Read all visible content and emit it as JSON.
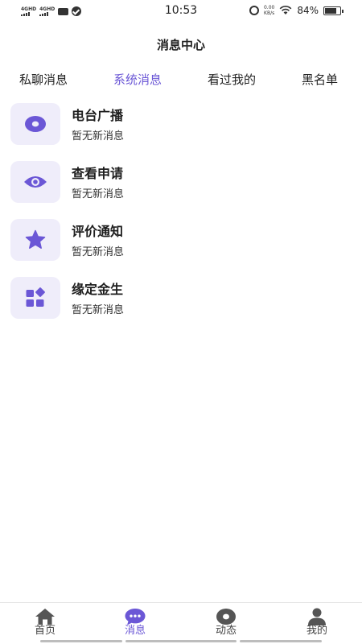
{
  "status_bar": {
    "net1": "4GHD",
    "net2": "4GHD",
    "time": "10:53",
    "speed_value": "0.00",
    "speed_unit": "KB/s",
    "battery": "84%",
    "battery_level": 0.84
  },
  "header": {
    "title": "消息中心"
  },
  "tabs": [
    {
      "label": "私聊消息",
      "active": false
    },
    {
      "label": "系统消息",
      "active": true
    },
    {
      "label": "看过我的",
      "active": false
    },
    {
      "label": "黑名单",
      "active": false
    }
  ],
  "items": [
    {
      "title": "电台广播",
      "subtitle": "暂无新消息",
      "icon": "radio-icon"
    },
    {
      "title": "查看申请",
      "subtitle": "暂无新消息",
      "icon": "eye-icon"
    },
    {
      "title": "评价通知",
      "subtitle": "暂无新消息",
      "icon": "star-icon"
    },
    {
      "title": "缘定金生",
      "subtitle": "暂无新消息",
      "icon": "apps-icon"
    }
  ],
  "bottom_nav": [
    {
      "label": "首页",
      "icon": "home-icon",
      "active": false
    },
    {
      "label": "消息",
      "icon": "chat-bubble-icon",
      "active": true
    },
    {
      "label": "动态",
      "icon": "disc-icon",
      "active": false
    },
    {
      "label": "我的",
      "icon": "person-icon",
      "active": false
    }
  ],
  "colors": {
    "accent": "#6b57d6",
    "icon_bg": "#efedfa",
    "icon_dark": "#555555"
  }
}
